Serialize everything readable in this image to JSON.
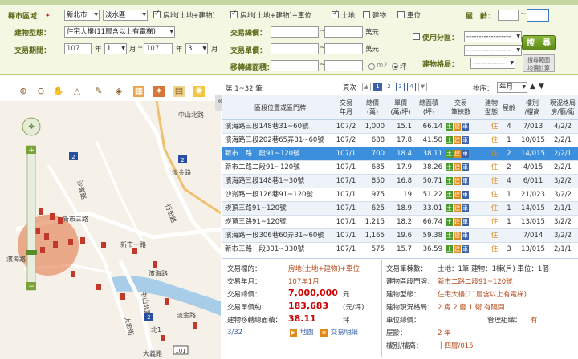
{
  "search": {
    "county_label": "縣市區域：",
    "county": "新北市",
    "district": "淡水區",
    "type_checks": [
      {
        "label": "房地(土地+建物)",
        "checked": true
      },
      {
        "label": "房地(土地+建物)+車位",
        "checked": true
      },
      {
        "label": "土地",
        "checked": true
      },
      {
        "label": "建物",
        "checked": false
      },
      {
        "label": "車位",
        "checked": false
      }
    ],
    "age_label": "屋　齡：",
    "age_sep": "~",
    "building_type_label": "建物型態：",
    "building_type": "住宅大樓(11層含以上有電梯)",
    "total_price_label": "交易總價：",
    "total_unit": "萬元",
    "unit_price_label": "交易單價：",
    "unit_price_unit": "萬元",
    "use_zone_label": "使用分區：",
    "use_zone": "------------------",
    "use_zone_sub": "------------------",
    "period_label": "交易期間：",
    "year_from": "107",
    "month_from": "1",
    "year_to": "107",
    "month_to": "3",
    "year_unit": "年",
    "month_unit": "月",
    "period_sep": "~",
    "range_sep": "~",
    "area_label": "移轉總面積：",
    "area_units": [
      "m2",
      "坪"
    ],
    "layout_label": "建物格局：",
    "layout": "-------------",
    "search_button": "搜　尋",
    "calc_button_line1": "搜尋範圍",
    "calc_button_line2": "均價計算"
  },
  "results": {
    "page_label": "第 1~32 筆",
    "pages_label": "頁次",
    "pages": [
      "1",
      "2",
      "3",
      "4"
    ],
    "sort_label": "排序：",
    "sort_value": "年月",
    "headers": [
      [
        "區段位置或區門牌"
      ],
      [
        "交易",
        "年月"
      ],
      [
        "總價",
        "(萬)"
      ],
      [
        "單價",
        "(萬/坪)"
      ],
      [
        "總面積",
        "(坪)"
      ],
      [
        "交易",
        "筆棟數"
      ],
      [
        "建物",
        "型態"
      ],
      [
        "屋齡"
      ],
      [
        "樓別",
        "/樓高"
      ],
      [
        "現況格局",
        "房/廳/衛"
      ]
    ],
    "rows": [
      {
        "addr": "濱海路三段148巷31~60號",
        "ym": "107/2",
        "total": "1,000",
        "unit": "15.1",
        "area": "66.14",
        "tags": [
          "土",
          "建",
          "車"
        ],
        "btype": "住",
        "age": "4",
        "floor": "7/013",
        "layout": "4/2/2"
      },
      {
        "addr": "濱海路三段202巷65弄31~60號",
        "ym": "107/2",
        "total": "688",
        "unit": "17.8",
        "area": "41.50",
        "tags": [
          "土",
          "建",
          "車"
        ],
        "btype": "住",
        "age": "1",
        "floor": "10/015",
        "layout": "2/2/1"
      },
      {
        "addr": "新市二路二段91~120號",
        "ym": "107/1",
        "total": "700",
        "unit": "18.4",
        "area": "38.11",
        "tags": [
          "土",
          "建",
          "車"
        ],
        "btype": "住",
        "age": "2",
        "floor": "14/015",
        "layout": "2/2/1"
      },
      {
        "addr": "新市二路二段91~120號",
        "ym": "107/1",
        "total": "685",
        "unit": "17.9",
        "area": "38.26",
        "tags": [
          "土",
          "建",
          "車"
        ],
        "btype": "住",
        "age": "2",
        "floor": "4/015",
        "layout": "2/2/1"
      },
      {
        "addr": "濱海路三段148巷1~30號",
        "ym": "107/1",
        "total": "850",
        "unit": "16.8",
        "area": "50.71",
        "tags": [
          "土",
          "建",
          "車"
        ],
        "btype": "住",
        "age": "4",
        "floor": "6/011",
        "layout": "3/2/2"
      },
      {
        "addr": "沙崙路一段126巷91~120號",
        "ym": "107/1",
        "total": "975",
        "unit": "19",
        "area": "51.22",
        "tags": [
          "土",
          "建",
          "車"
        ],
        "btype": "住",
        "age": "1",
        "floor": "21/023",
        "layout": "3/2/2"
      },
      {
        "addr": "崁頂三路91~120號",
        "ym": "107/1",
        "total": "625",
        "unit": "18.9",
        "area": "33.01",
        "tags": [
          "土",
          "建",
          "車"
        ],
        "btype": "住",
        "age": "1",
        "floor": "14/015",
        "layout": "2/1/1"
      },
      {
        "addr": "崁頂三路91~120號",
        "ym": "107/1",
        "total": "1,215",
        "unit": "18.2",
        "area": "66.74",
        "tags": [
          "土",
          "建",
          "車"
        ],
        "btype": "住",
        "age": "1",
        "floor": "13/015",
        "layout": "3/2/2"
      },
      {
        "addr": "濱海路一段306巷60弄31~60號",
        "ym": "107/1",
        "total": "1,165",
        "unit": "19.6",
        "area": "59.38",
        "tags": [
          "土",
          "建",
          "車"
        ],
        "btype": "住",
        "age": "",
        "floor": "7/014",
        "layout": "3/2/2"
      },
      {
        "addr": "新市三路一段301~330號",
        "ym": "107/1",
        "total": "575",
        "unit": "15.7",
        "area": "36.59",
        "tags": [
          "土",
          "建",
          "車"
        ],
        "btype": "住",
        "age": "3",
        "floor": "13/015",
        "layout": "2/1/1"
      }
    ]
  },
  "detail": {
    "target_label": "交易標的：",
    "target": "房地(土地+建物)+車位",
    "ym_label": "交易年月：",
    "ym": "107年1月",
    "total_label": "交易總價：",
    "total": "7,000,000",
    "total_unit": "元",
    "unit_label": "交易單價約：",
    "unit": "183,683",
    "unit_unit": "(元/坪)",
    "area_label": "建物移轉總面積：",
    "area": "38.11",
    "area_unit": "坪",
    "index": "3/32",
    "map_link": "地圖",
    "detail_link": "交易明細",
    "count_label": "交易筆棟數：",
    "count": "土地：1筆 建物：1棟(戶) 車位：1個",
    "addr_label": "建物區段門牌：",
    "addr": "新市二路二段91~120號",
    "btype_label": "建物型態：",
    "btype": "住宅大樓(11層含以上有電梯)",
    "layout_label": "建物現況格局：",
    "layout": "2 房 2 廳 1 衛 有隔間",
    "parking_label": "車位總價：",
    "mgmt_label": "管理組織：",
    "mgmt": "有",
    "age_label": "屋齡：",
    "age": "2 年",
    "floor_label": "樓別/樓高：",
    "floor": "十四層/015"
  },
  "map": {
    "labels": [
      "中山北路",
      "淡金路",
      "行忠路",
      "新市三路",
      "濱海路",
      "沙崙路",
      "濱海路",
      "新市一路",
      "大忠街",
      "淡金路",
      "大義路",
      "北1",
      "中山北路"
    ],
    "shields": [
      "2",
      "2",
      "2",
      "101"
    ],
    "colors": {
      "road": "#ffffff",
      "river": "#a8cde8",
      "circle": "#e0703a",
      "pin": "#c0392b"
    }
  }
}
